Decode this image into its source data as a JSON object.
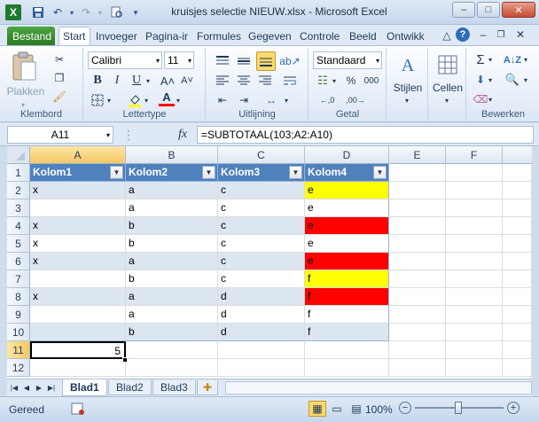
{
  "window": {
    "title": "kruisjes selectie NIEUW.xlsx  -  Microsoft Excel",
    "min_label": "–",
    "max_label": "□",
    "close_label": "✕"
  },
  "qat": {
    "icon": "excel-icon",
    "save_icon": "save-icon",
    "undo_icon": "undo-icon",
    "redo_icon": "redo-icon",
    "print_icon": "print-preview-icon",
    "customize_icon": "customize-icon"
  },
  "tabs": [
    "Bestand",
    "Start",
    "Invoeger",
    "Pagina-ir",
    "Formules",
    "Gegeven",
    "Controle",
    "Beeld",
    "Ontwikk"
  ],
  "ribbon": {
    "clipboard": {
      "label": "Klembord",
      "paste": "Plakken"
    },
    "font": {
      "label": "Lettertype",
      "name": "Calibri",
      "size": "11",
      "bold": "B",
      "italic": "I",
      "underline": "U",
      "grow": "A˄",
      "shrink": "A˅"
    },
    "align": {
      "label": "Uitlijning"
    },
    "number": {
      "label": "Getal",
      "format": "Standaard",
      "percent": "%",
      "thousands": "000"
    },
    "styles": {
      "label": "Stijlen"
    },
    "cells": {
      "label": "Cellen"
    },
    "editing": {
      "label": "Bewerken",
      "sum": "Σ"
    }
  },
  "formula_bar": {
    "name_box": "A11",
    "fx": "fx",
    "formula": "=SUBTOTAAL(103;A2:A10)"
  },
  "sheet": {
    "columns": [
      "A",
      "B",
      "C",
      "D",
      "E",
      "F"
    ],
    "rows": [
      "1",
      "2",
      "3",
      "4",
      "5",
      "6",
      "7",
      "8",
      "9",
      "10",
      "11",
      "12"
    ],
    "headers": [
      "Kolom1",
      "Kolom2",
      "Kolom3",
      "Kolom4"
    ],
    "data": [
      [
        "x",
        "a",
        "c",
        "e"
      ],
      [
        "",
        "a",
        "c",
        "e"
      ],
      [
        "x",
        "b",
        "c",
        "e"
      ],
      [
        "x",
        "b",
        "c",
        "e"
      ],
      [
        "x",
        "a",
        "c",
        "e"
      ],
      [
        "",
        "b",
        "c",
        "f"
      ],
      [
        "x",
        "a",
        "d",
        "f"
      ],
      [
        "",
        "a",
        "d",
        "f"
      ],
      [
        "",
        "b",
        "d",
        "f"
      ]
    ],
    "kolom4_fill": [
      "#ffff00",
      "",
      "#ff0000",
      "",
      "#ff0000",
      "#ffff00",
      "#ff0000",
      "",
      ""
    ],
    "total_value": "5",
    "active_cell": "A11"
  },
  "sheet_tabs": [
    "Blad1",
    "Blad2",
    "Blad3"
  ],
  "status": {
    "ready": "Gereed",
    "zoom": "100%"
  }
}
